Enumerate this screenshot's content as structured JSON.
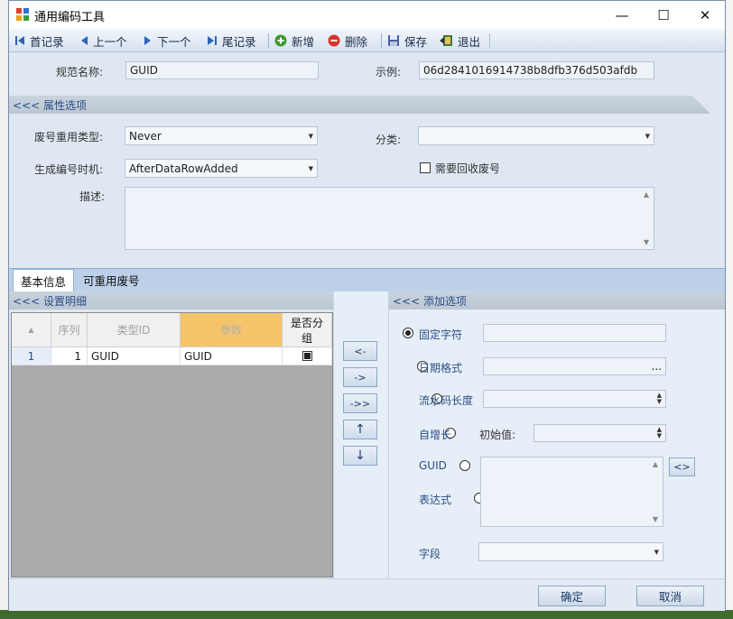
{
  "window": {
    "title": "通用编码工具",
    "controls": {
      "minimize": "—",
      "maximize": "☐",
      "close": "✕"
    }
  },
  "toolbar": {
    "first": "首记录",
    "prev": "上一个",
    "next": "下一个",
    "last": "尾记录",
    "add": "新增",
    "delete": "删除",
    "save": "保存",
    "exit": "退出"
  },
  "form": {
    "spec_name_label": "规范名称:",
    "spec_name_value": "GUID",
    "example_label": "示例:",
    "example_value": "06d2841016914738b8dfb376d503afdb"
  },
  "properties": {
    "section_title": "<<< 属性选项",
    "reuse_type_label": "废号重用类型:",
    "reuse_type_value": "Never",
    "category_label": "分类:",
    "category_value": "",
    "gen_time_label": "生成编号时机:",
    "gen_time_value": "AfterDataRowAdded",
    "recycle_label": "需要回收废号",
    "recycle_checked": false,
    "desc_label": "描述:",
    "desc_value": ""
  },
  "tabs": [
    {
      "label": "基本信息",
      "active": true
    },
    {
      "label": "可重用废号",
      "active": false
    }
  ],
  "details": {
    "section_title": "<<< 设置明细",
    "columns": {
      "seq": "序列",
      "type_id": "类型ID",
      "param": "参数",
      "grouped": "是否分组"
    },
    "rows": [
      {
        "row_num": "1",
        "seq": "1",
        "type_id": "GUID",
        "param": "GUID",
        "grouped": true
      }
    ]
  },
  "mid_buttons": {
    "left": "<-",
    "right": "->",
    "right_all": "->>",
    "up": "↑",
    "down": "↓"
  },
  "add_options": {
    "section_title": "<<< 添加选项",
    "fixed_char": "固定字符",
    "date_format": "日期格式",
    "date_ellipsis": "...",
    "serial_length": "流水码长度",
    "auto_inc": "自增长",
    "initial_label": "初始值:",
    "guid": "GUID",
    "expression": "表达式",
    "expr_button": "<>",
    "field": "字段",
    "selected": "fixed_char"
  },
  "footer": {
    "ok": "确定",
    "cancel": "取消"
  },
  "colors": {
    "accent": "#2a4f86",
    "header_highlight": "#f5c46a",
    "section": "#c4cfdb"
  }
}
